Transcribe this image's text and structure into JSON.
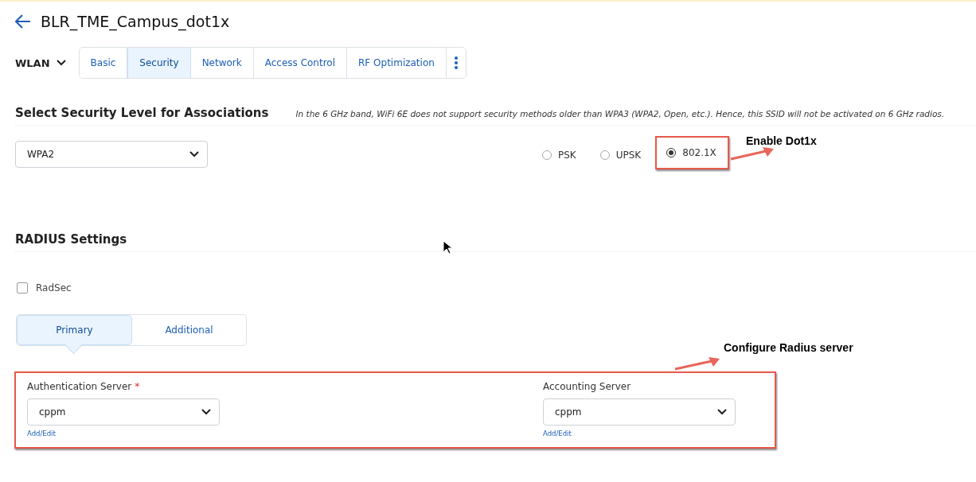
{
  "page": {
    "title": "BLR_TME_Campus_dot1x"
  },
  "context": {
    "label": "WLAN"
  },
  "tabs": [
    {
      "label": "Basic",
      "selected": false
    },
    {
      "label": "Security",
      "selected": true
    },
    {
      "label": "Network",
      "selected": false
    },
    {
      "label": "Access Control",
      "selected": false
    },
    {
      "label": "RF Optimization",
      "selected": false
    }
  ],
  "security": {
    "title": "Select Security Level for Associations",
    "note": "In the 6 GHz band, WiFi 6E does not support security methods older than WPA3 (WPA2, Open, etc.). Hence, this SSID will not be activated on 6 GHz radios.",
    "level": "WPA2",
    "options": [
      {
        "label": "PSK",
        "selected": false,
        "highlighted": false
      },
      {
        "label": "UPSK",
        "selected": false,
        "highlighted": false
      },
      {
        "label": "802.1X",
        "selected": true,
        "highlighted": true
      }
    ]
  },
  "radius": {
    "title": "RADIUS Settings",
    "radsec": {
      "label": "RadSec",
      "checked": false
    },
    "subtabs": [
      {
        "label": "Primary",
        "selected": true
      },
      {
        "label": "Additional",
        "selected": false
      }
    ],
    "servers": [
      {
        "label": "Authentication Server",
        "required_mark": "*",
        "value": "cppm",
        "link": "Add/Edit"
      },
      {
        "label": "Accounting Server",
        "value": "cppm",
        "link": "Add/Edit"
      }
    ]
  },
  "annotations": [
    {
      "text": "Enable Dot1x"
    },
    {
      "text": "Configure Radius server"
    }
  ]
}
